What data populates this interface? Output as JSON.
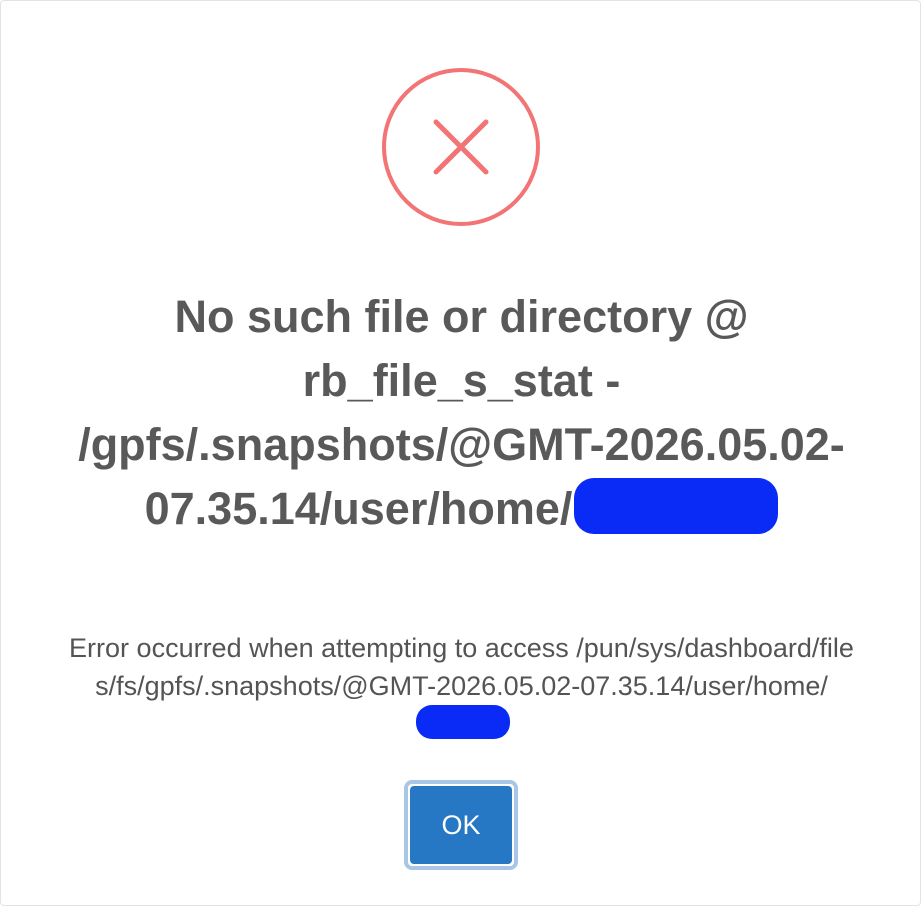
{
  "dialog": {
    "title": "No such file or directory @ rb_file_s_stat - /gpfs/.snapshots/@GMT-2026.05.02-07.35.14/user/home/",
    "message": "Error occurred when attempting to access /pun/sys/dashboard/files/fs/gpfs/.snapshots/@GMT-2026.05.02-07.35.14/user/home/",
    "ok_label": "OK",
    "icon": "error-x-icon"
  },
  "colors": {
    "error_accent": "#f27474",
    "button": "#2778c4",
    "button_focus_ring": "#a8c7e6",
    "title_text": "#595959",
    "message_text": "#545454",
    "redaction": "#0a2bf5"
  }
}
